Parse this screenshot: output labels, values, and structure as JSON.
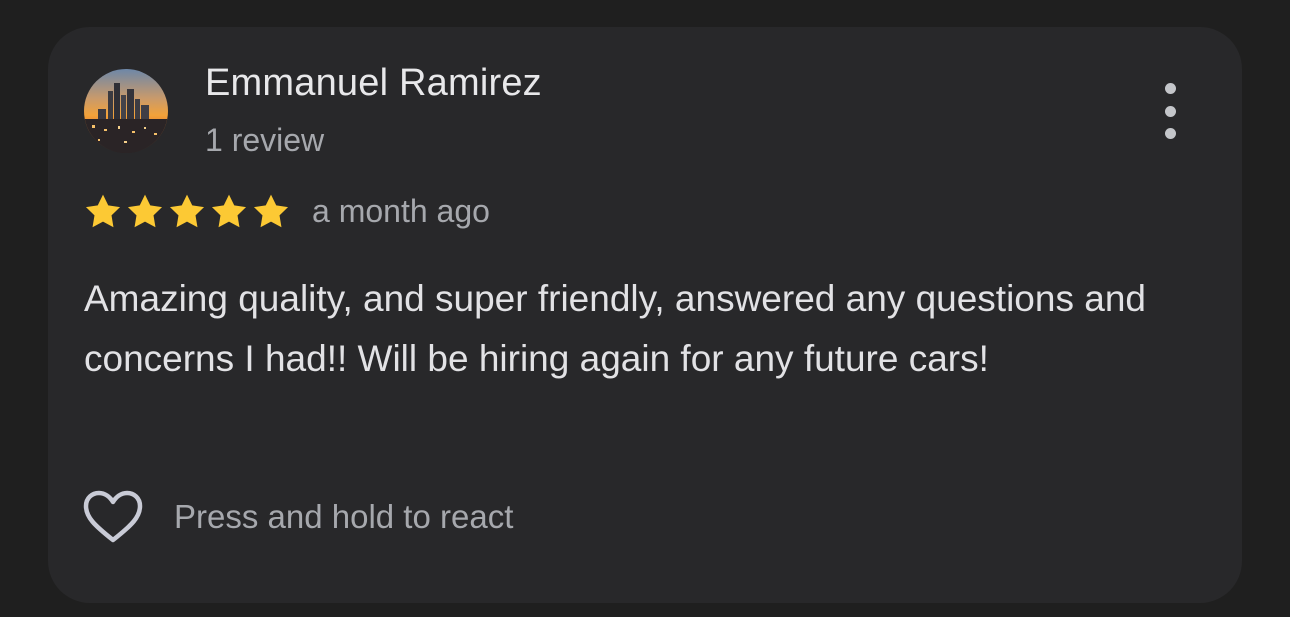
{
  "review": {
    "author_name": "Emmanuel Ramirez",
    "review_count": "1 review",
    "rating": 5,
    "rating_max": 5,
    "time_ago": "a month ago",
    "text": "Amazing quality, and super friendly, answered any questions and concerns I had!! Will be hiring again for any future cars!",
    "react_label": "Press and hold to react"
  },
  "icons": {
    "avatar": "city-skyline-avatar",
    "menu": "more-vertical-icon",
    "star": "star-icon",
    "react": "heart-outline-icon"
  },
  "colors": {
    "background": "#1f1f1f",
    "card": "#28282a",
    "star": "#fcc934",
    "primary_text": "#e8e8ea",
    "secondary_text": "#a6a8ad"
  }
}
